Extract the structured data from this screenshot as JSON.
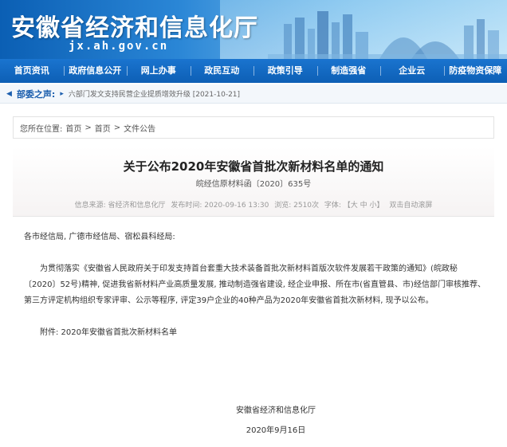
{
  "header": {
    "site_title": "安徽省经济和信息化厅",
    "domain": "jx.ah.gov.cn",
    "brand_color": "#0d5fb5"
  },
  "nav": {
    "items": [
      "首页资讯",
      "政府信息公开",
      "网上办事",
      "政民互动",
      "政策引导",
      "制造强省",
      "企业云",
      "防疫物资保障"
    ]
  },
  "notice": {
    "label": "部委之声:",
    "link": "六部门发文支持民营企业提质增效升级 [2021-10-21]"
  },
  "breadcrumb": {
    "prefix": "您所在位置:",
    "items": [
      "首页",
      "首页",
      "文件公告"
    ],
    "separator": ">"
  },
  "article": {
    "title": "关于公布2020年安徽省首批次新材料名单的通知",
    "doc_number": "皖经信原材料函〔2020〕635号",
    "meta": {
      "source": "信息来源: 省经济和信息化厅",
      "date": "发布时间: 2020-09-16 13:30",
      "views": "浏览: 2510次",
      "font": "字体: 【大 中 小】",
      "dblclick": "双击自动滚屏"
    },
    "salutation": "各市经信局, 广德市经信局、宿松县科经局:",
    "body": "为贯彻落实《安徽省人民政府关于印发支持首台套重大技术装备首批次新材料首版次软件发展若干政策的通知》(皖政秘〔2020〕52号)精神, 促进我省新材料产业高质量发展, 推动制造强省建设, 经企业申报、所在市(省直管县、市)经信部门审核推荐、第三方评定机构组织专家评审、公示等程序, 评定39户企业的40种产品为2020年安徽省首批次新材料, 现予以公布。",
    "attachment": "附件: 2020年安徽省首批次新材料名单",
    "signature": "安徽省经济和信息化厅",
    "sign_date": "2020年9月16日"
  }
}
